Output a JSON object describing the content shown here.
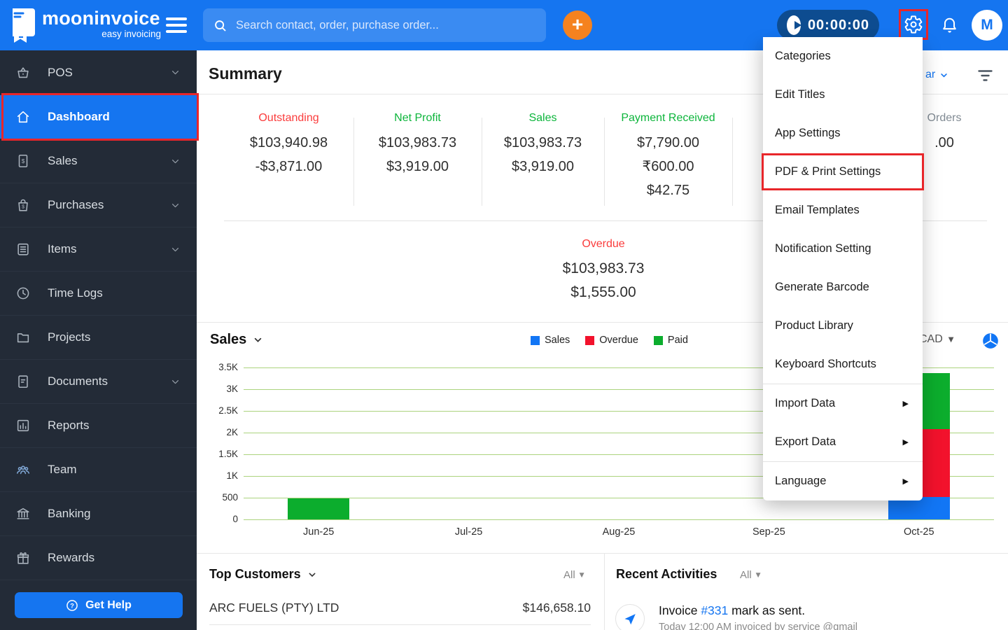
{
  "topbar": {
    "brand": {
      "name": "mooninvoice",
      "tagline": "easy invoicing"
    },
    "search": {
      "placeholder": "Search contact, order, purchase order..."
    },
    "timer": {
      "value": "00:00:00"
    },
    "avatar": {
      "initial": "M"
    }
  },
  "sidebar": {
    "items": [
      {
        "label": "POS",
        "icon": "basket",
        "expandable": true
      },
      {
        "label": "Dashboard",
        "icon": "home",
        "active": true
      },
      {
        "label": "Sales",
        "icon": "invoice",
        "expandable": true
      },
      {
        "label": "Purchases",
        "icon": "bag",
        "expandable": true
      },
      {
        "label": "Items",
        "icon": "list",
        "expandable": true
      },
      {
        "label": "Time Logs",
        "icon": "clock"
      },
      {
        "label": "Projects",
        "icon": "folder"
      },
      {
        "label": "Documents",
        "icon": "document",
        "expandable": true
      },
      {
        "label": "Reports",
        "icon": "bar-chart"
      },
      {
        "label": "Team",
        "icon": "team"
      },
      {
        "label": "Banking",
        "icon": "bank"
      },
      {
        "label": "Rewards",
        "icon": "gift"
      }
    ],
    "get_help_label": "Get Help"
  },
  "summary": {
    "title": "Summary",
    "period_fragment": "ar",
    "cards": [
      {
        "label": "Outstanding",
        "color": "#FA3C3C",
        "values": [
          "$103,940.98",
          "-$3,871.00"
        ]
      },
      {
        "label": "Net Profit",
        "color": "#0CB53B",
        "values": [
          "$103,983.73",
          "$3,919.00"
        ]
      },
      {
        "label": "Sales",
        "color": "#0CB53B",
        "values": [
          "$103,983.73",
          "$3,919.00"
        ]
      },
      {
        "label": "Payment Received",
        "color": "#0CB53B",
        "values": [
          "$7,790.00",
          "₹600.00",
          "$42.75"
        ]
      },
      {
        "label": "Orders",
        "color": "#808A93",
        "values": [
          ".00"
        ]
      }
    ],
    "overdue": {
      "label": "Overdue",
      "color": "#FA3C3C",
      "values": [
        "$103,983.73",
        "$1,555.00"
      ]
    }
  },
  "sales_panel": {
    "title": "Sales",
    "currency": "CAD",
    "legend": [
      {
        "label": "Sales",
        "color": "#1276F5"
      },
      {
        "label": "Overdue",
        "color": "#F2122C"
      },
      {
        "label": "Paid",
        "color": "#0CAD2D"
      }
    ]
  },
  "chart_data": {
    "type": "bar",
    "stacked": true,
    "categories": [
      "Jun-25",
      "Jul-25",
      "Aug-25",
      "Sep-25",
      "Oct-25"
    ],
    "series": [
      {
        "name": "Sales",
        "color": "#1276F5",
        "values": [
          0,
          0,
          0,
          0,
          520
        ]
      },
      {
        "name": "Overdue",
        "color": "#F2122C",
        "values": [
          0,
          0,
          0,
          0,
          1560
        ]
      },
      {
        "name": "Paid",
        "color": "#0CAD2D",
        "values": [
          490,
          0,
          0,
          0,
          1290
        ]
      }
    ],
    "title": "Sales",
    "xlabel": "",
    "ylabel": "",
    "ylim": [
      0,
      3500
    ],
    "yticks": [
      "3.5K",
      "3K",
      "2.5K",
      "2K",
      "1.5K",
      "1K",
      "500",
      "0"
    ],
    "grid": true,
    "legend_position": "top"
  },
  "settings_menu": {
    "items": [
      {
        "label": "Categories"
      },
      {
        "label": "Edit Titles"
      },
      {
        "label": "App Settings"
      },
      {
        "label": "PDF & Print Settings",
        "highlighted": true
      },
      {
        "label": "Email Templates"
      },
      {
        "label": "Notification Setting"
      },
      {
        "label": "Generate Barcode"
      },
      {
        "label": "Product Library"
      },
      {
        "label": "Keyboard Shortcuts",
        "divider_after": true
      },
      {
        "label": "Import Data",
        "submenu": true
      },
      {
        "label": "Export Data",
        "submenu": true,
        "divider_after": true
      },
      {
        "label": "Language",
        "submenu": true
      }
    ]
  },
  "top_customers": {
    "title": "Top Customers",
    "filter": "All",
    "rows": [
      {
        "name": "ARC FUELS (PTY) LTD",
        "amount": "$146,658.10"
      }
    ]
  },
  "recent_activities": {
    "title": "Recent Activities",
    "filter": "All",
    "items": [
      {
        "prefix": "Invoice ",
        "link": "#331",
        "suffix": " mark as sent.",
        "meta": "Today 12:00 AM invoiced by service @gmail"
      }
    ]
  }
}
